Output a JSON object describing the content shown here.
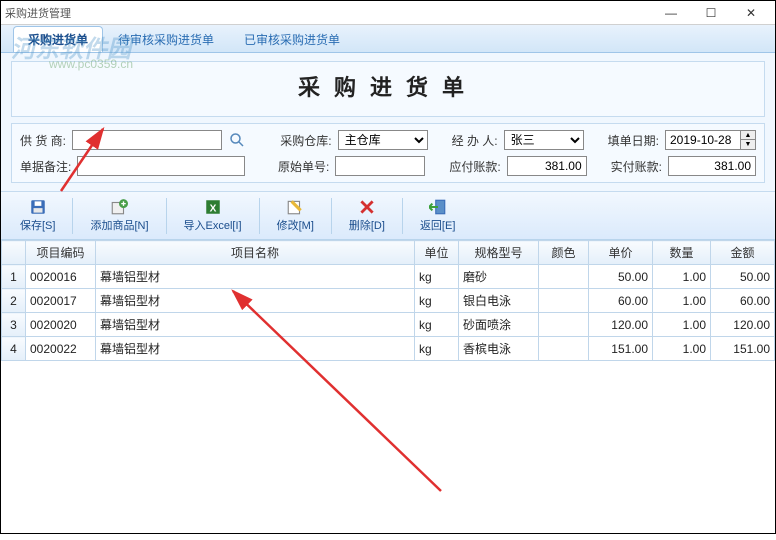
{
  "window": {
    "title": "采购进货管理"
  },
  "watermark": {
    "main": "河东软件园",
    "sub": "www.pc0359.cn"
  },
  "tabs": [
    {
      "label": "采购进货单",
      "active": true
    },
    {
      "label": "待审核采购进货单",
      "active": false
    },
    {
      "label": "已审核采购进货单",
      "active": false
    }
  ],
  "form": {
    "title": "采购进货单",
    "supplier_label": "供 货 商:",
    "supplier_value": "",
    "warehouse_label": "采购仓库:",
    "warehouse_value": "主仓库",
    "handler_label": "经 办 人:",
    "handler_value": "张三",
    "date_label": "填单日期:",
    "date_value": "2019-10-28",
    "remark_label": "单据备注:",
    "remark_value": "",
    "origno_label": "原始单号:",
    "origno_value": "",
    "payable_label": "应付账款:",
    "payable_value": "381.00",
    "paid_label": "实付账款:",
    "paid_value": "381.00"
  },
  "toolbar": {
    "save": "保存[S]",
    "add": "添加商品[N]",
    "import": "导入Excel[I]",
    "edit": "修改[M]",
    "delete": "删除[D]",
    "back": "返回[E]"
  },
  "columns": {
    "code": "项目编码",
    "name": "项目名称",
    "unit": "单位",
    "spec": "规格型号",
    "color": "颜色",
    "price": "单价",
    "qty": "数量",
    "amount": "金额"
  },
  "rows": [
    {
      "n": "1",
      "code": "0020016",
      "name": "幕墙铝型材",
      "unit": "kg",
      "spec": "磨砂",
      "color": "",
      "price": "50.00",
      "qty": "1.00",
      "amount": "50.00"
    },
    {
      "n": "2",
      "code": "0020017",
      "name": "幕墙铝型材",
      "unit": "kg",
      "spec": "银白电泳",
      "color": "",
      "price": "60.00",
      "qty": "1.00",
      "amount": "60.00"
    },
    {
      "n": "3",
      "code": "0020020",
      "name": "幕墙铝型材",
      "unit": "kg",
      "spec": "砂面喷涂",
      "color": "",
      "price": "120.00",
      "qty": "1.00",
      "amount": "120.00"
    },
    {
      "n": "4",
      "code": "0020022",
      "name": "幕墙铝型材",
      "unit": "kg",
      "spec": "香槟电泳",
      "color": "",
      "price": "151.00",
      "qty": "1.00",
      "amount": "151.00"
    }
  ]
}
